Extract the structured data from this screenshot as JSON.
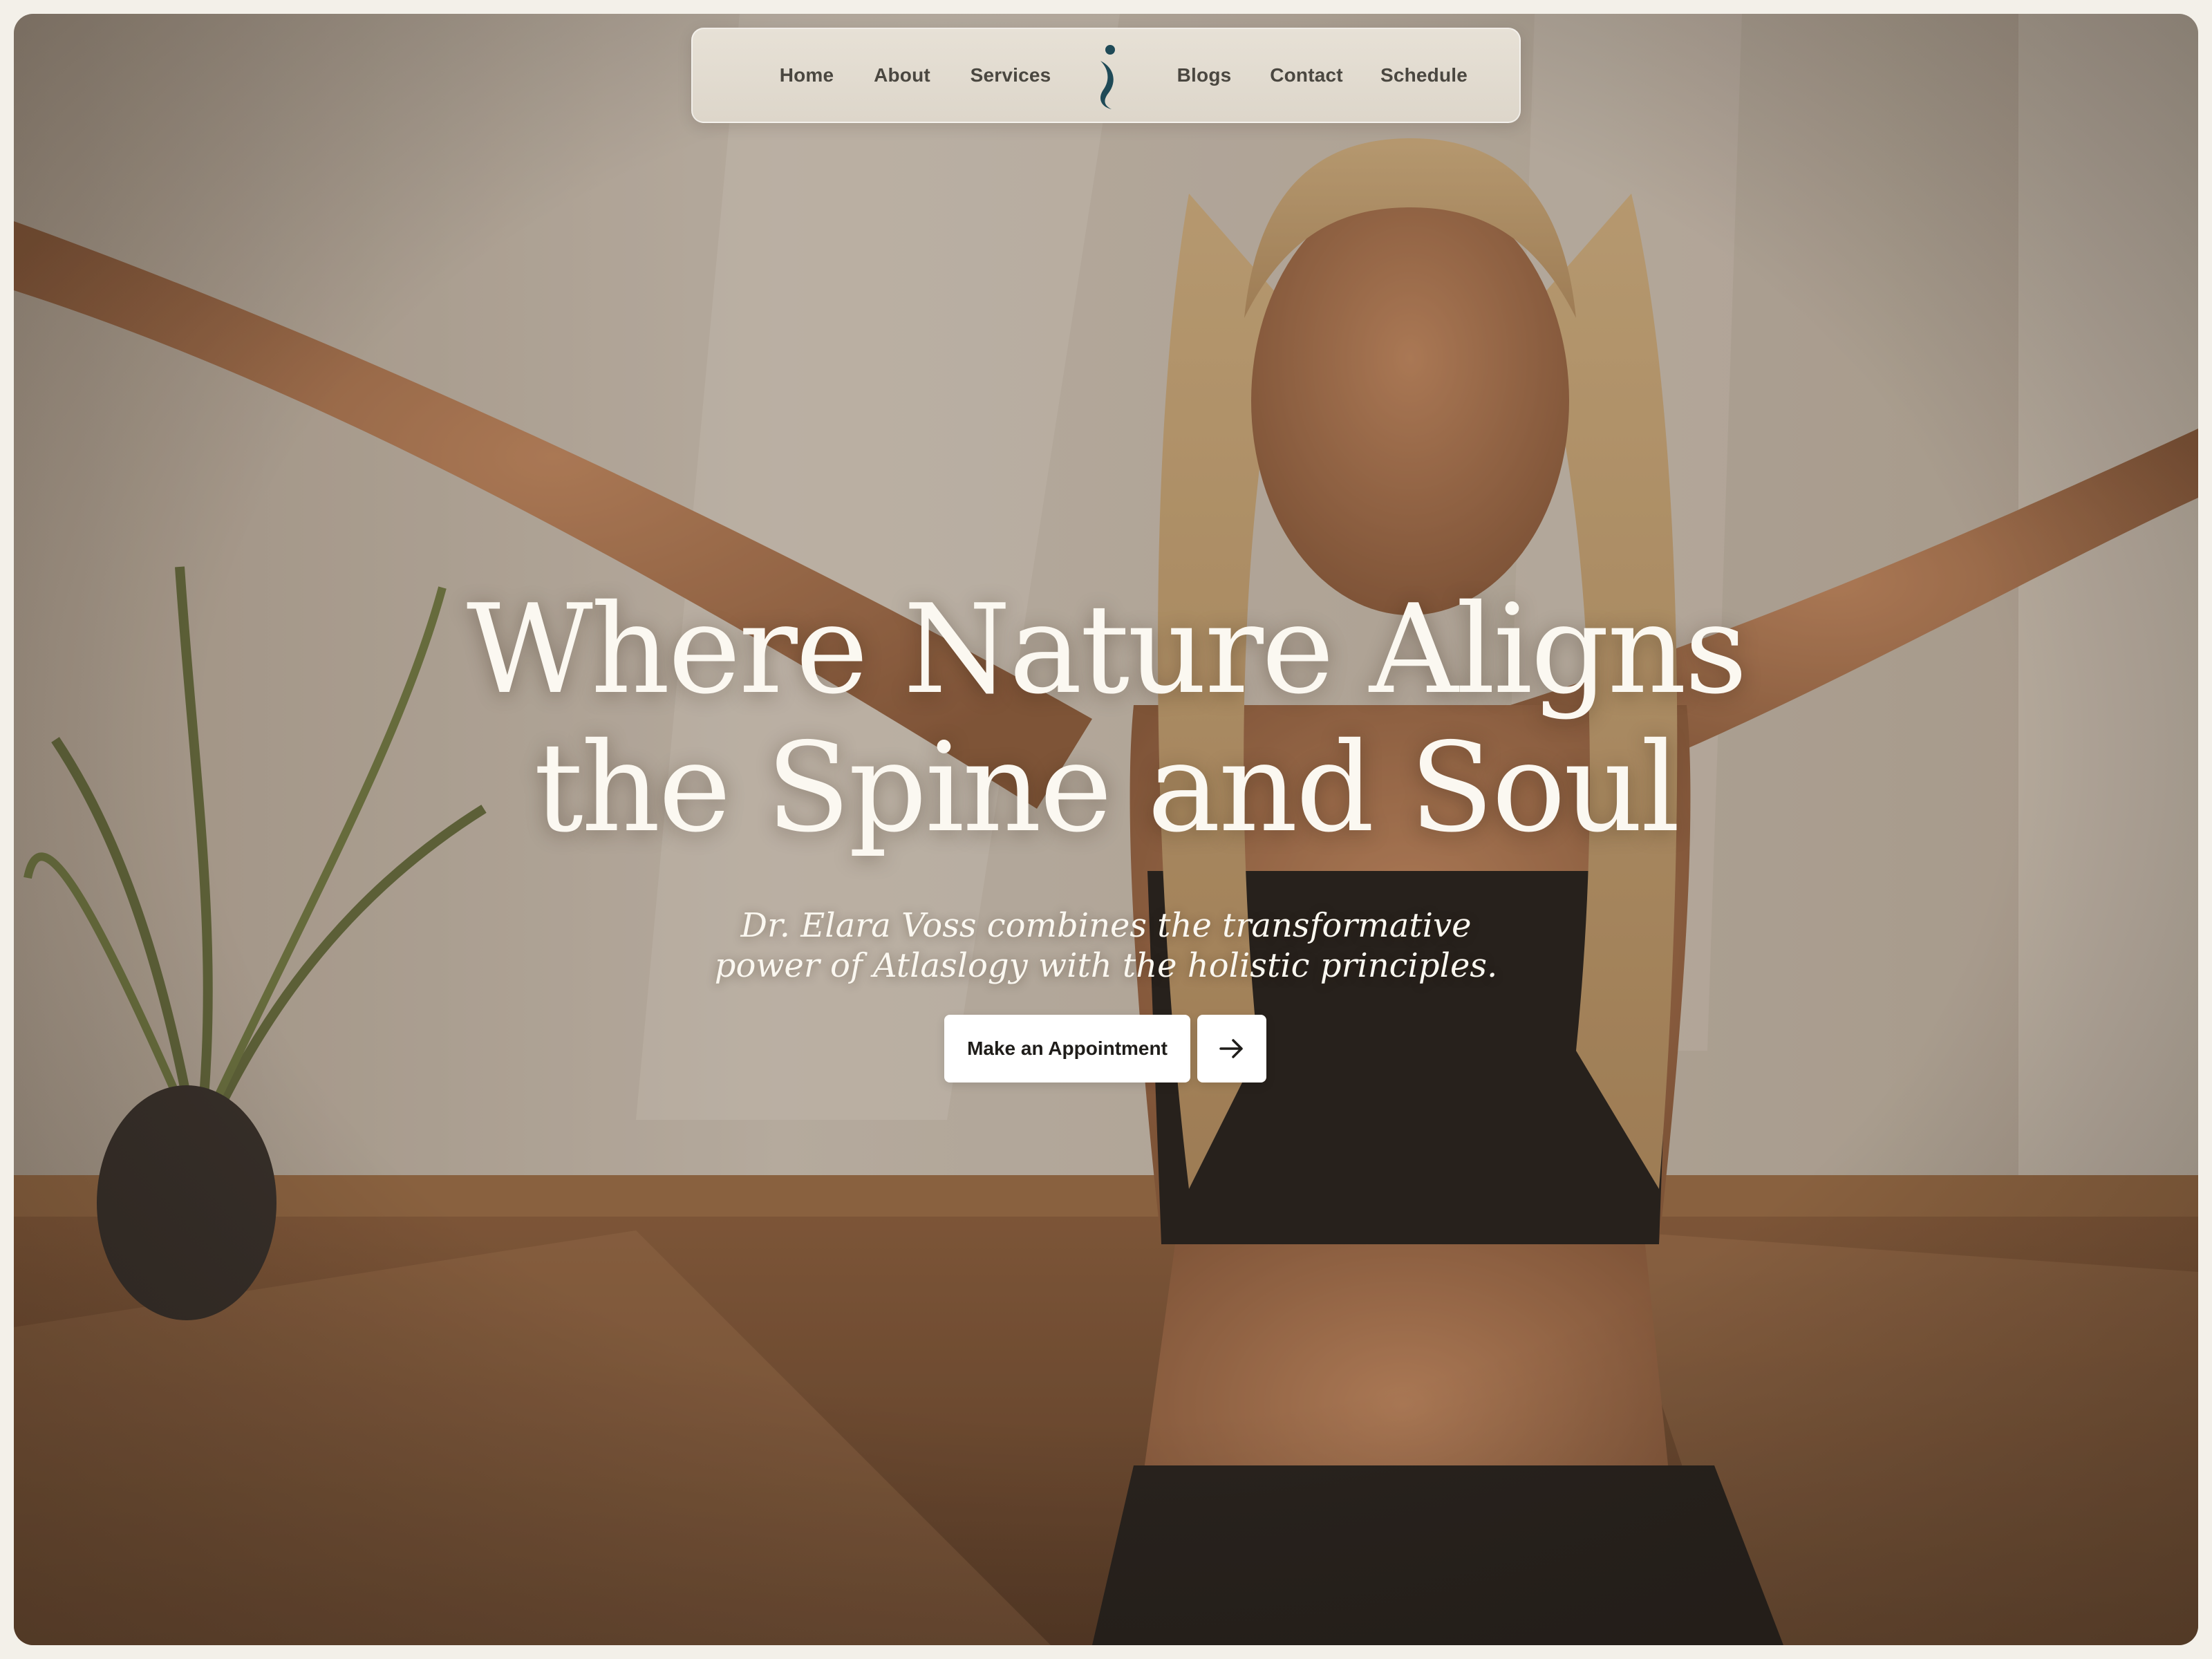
{
  "nav": {
    "items_left": [
      "Home",
      "About",
      "Services"
    ],
    "items_right": [
      "Blogs",
      "Contact",
      "Schedule"
    ],
    "logo_icon": "spine-s-logo-icon"
  },
  "hero": {
    "title_line1": "Where Nature Aligns",
    "title_line2": "the Spine and Soul",
    "subtitle_line1": "Dr. Elara Voss combines the transformative",
    "subtitle_line2": "power of Atlaslogy with the holistic principles.",
    "cta_label": "Make an Appointment",
    "cta_arrow_icon": "arrow-right-icon"
  },
  "colors": {
    "accent": "#1f4a57",
    "hero_text": "#fbf8f1",
    "nav_text": "#4a4740",
    "nav_bg": "#e2dcd1",
    "button_bg": "#ffffff"
  }
}
